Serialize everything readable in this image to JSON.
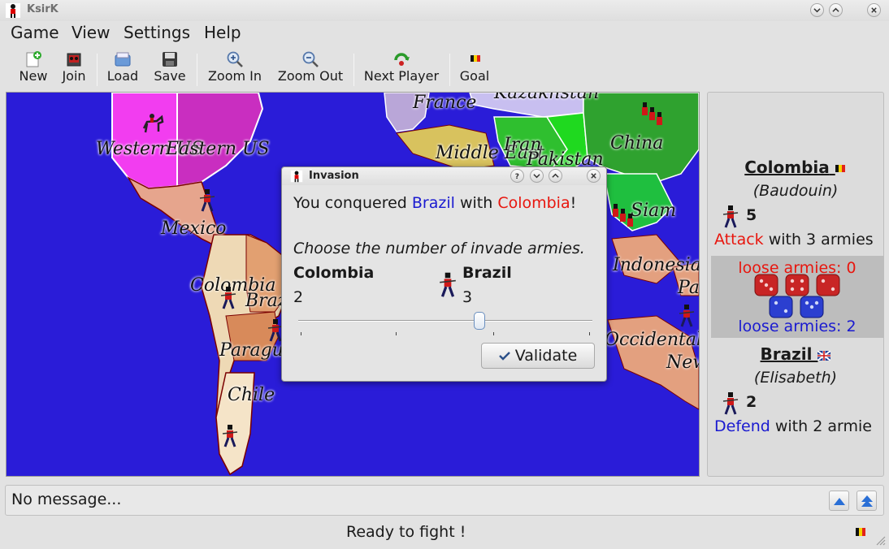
{
  "window": {
    "title": "KsirK"
  },
  "menu": [
    "Game",
    "View",
    "Settings",
    "Help"
  ],
  "toolbar": {
    "new": "New",
    "join": "Join",
    "load": "Load",
    "save": "Save",
    "zoom_in": "Zoom In",
    "zoom_out": "Zoom Out",
    "next_player": "Next Player",
    "goal": "Goal"
  },
  "map": {
    "labels": {
      "france": "France",
      "kazakhstan": "Kazakhstan",
      "western_us": "Western US",
      "eastern_us": "Eastern US",
      "china": "China",
      "middle_east": "Middle East",
      "iran": "Iran",
      "pakistan": "Pakistan",
      "mexico": "Mexico",
      "siam": "Siam",
      "indonesia": "Indonesia",
      "colombia": "Colombia",
      "brazil": "Brazil",
      "paraguay": "Paraguay",
      "chile": "Chile",
      "occidental": "Occidental",
      "new": "New",
      "pa": "Pa"
    }
  },
  "dialog": {
    "title": "Invasion",
    "msg_prefix": "You conquered ",
    "msg_target": "Brazil",
    "msg_mid": " with ",
    "msg_source": "Colombia",
    "msg_suffix": "!",
    "question": "Choose the number of invade armies.",
    "left_country": "Colombia",
    "left_count": "2",
    "right_country": "Brazil",
    "right_count": "3",
    "slider_value_fraction": 0.62,
    "validate_label": "Validate"
  },
  "side": {
    "attacker": {
      "country": "Colombia",
      "player": "(Baudouin)",
      "armies": "5",
      "action": "Attack",
      "action_rest": " with 3 armies"
    },
    "loose_top": "loose armies: 0",
    "loose_bottom": "loose armies: 2",
    "defender": {
      "country": "Brazil",
      "player": "(Elisabeth)",
      "armies": "2",
      "action": "Defend",
      "action_rest": " with 2 armie"
    }
  },
  "message": "No message...",
  "status": "Ready to fight !",
  "colors": {
    "attack": "#e8160e",
    "defend": "#1a1ad0",
    "ocean": "#2a1cd8"
  }
}
